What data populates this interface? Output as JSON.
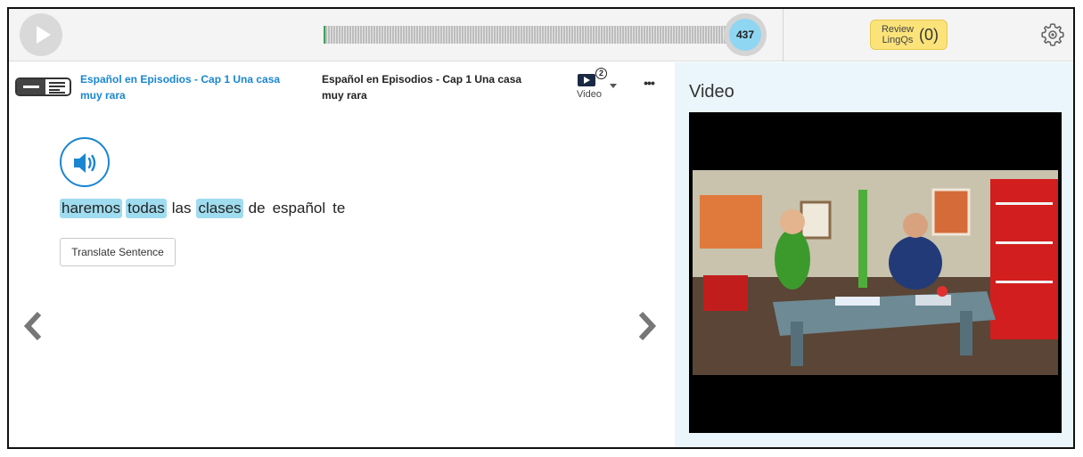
{
  "topbar": {
    "play_icon": "play-icon",
    "progress_fraction": 1.0,
    "counter": "437",
    "review": {
      "label": "Review LingQs",
      "count": "(0)"
    },
    "settings_icon": "gear-icon"
  },
  "reader": {
    "course_link": "Español en Episodios - Cap 1 Una casa muy rara",
    "lesson_title": "Español en Episodios - Cap 1 Una casa muy rara",
    "video_toggle": {
      "badge": "2",
      "label": "Video"
    },
    "more_icon": "more-icon",
    "audio_icon": "speaker-icon",
    "words": [
      {
        "text": "haremos",
        "lingq": true
      },
      {
        "text": "todas",
        "lingq": true
      },
      {
        "text": "las",
        "lingq": false
      },
      {
        "text": "clases",
        "lingq": true
      },
      {
        "text": "de",
        "lingq": false
      },
      {
        "text": "español",
        "lingq": false
      },
      {
        "text": "te",
        "lingq": false
      }
    ],
    "translate_button": "Translate Sentence"
  },
  "video_pane": {
    "heading": "Video"
  },
  "colors": {
    "accent": "#1a86d0",
    "lingq_highlight": "#9fdcef",
    "review_bg": "#fbe37a",
    "counter_bg": "#8fd6f2",
    "video_pane_bg": "#eaf6fb"
  }
}
